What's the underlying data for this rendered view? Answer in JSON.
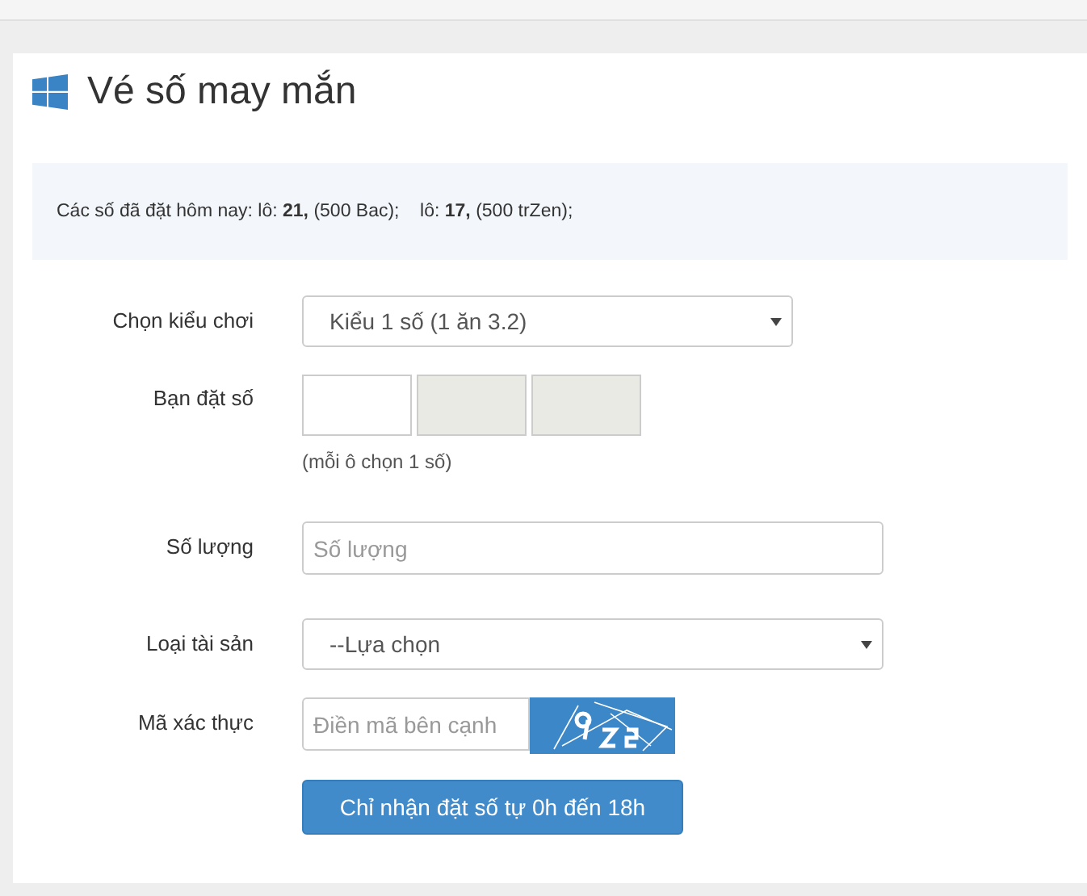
{
  "panel": {
    "title": "Vé số may mắn"
  },
  "summary": "Các số đã đặt hôm nay: lô: **21,** (500 Bac);    lô: **17,** (500 trZen);",
  "form": [
    {
      "kind": "select",
      "label": "Chọn kiểu chơi",
      "value": "Kiểu 1 số (1 ăn 3.2)"
    },
    {
      "kind": "boxes",
      "label": "Bạn đặt số",
      "boxes": [
        {
          "disabled": false
        },
        {
          "disabled": true
        },
        {
          "disabled": true
        }
      ],
      "hint": "(mỗi ô chọn 1 số)"
    },
    {
      "kind": "text",
      "label": "Số lượng",
      "placeholder": "Số lượng"
    },
    {
      "kind": "select",
      "label": "Loại tài sản",
      "value": "--Lựa chọn"
    },
    {
      "kind": "captcha",
      "label": "Mã xác thực",
      "placeholder": "Điền mã bên cạnh"
    }
  ],
  "button": "Chỉ nhận đặt số tự 0h đến 18h"
}
